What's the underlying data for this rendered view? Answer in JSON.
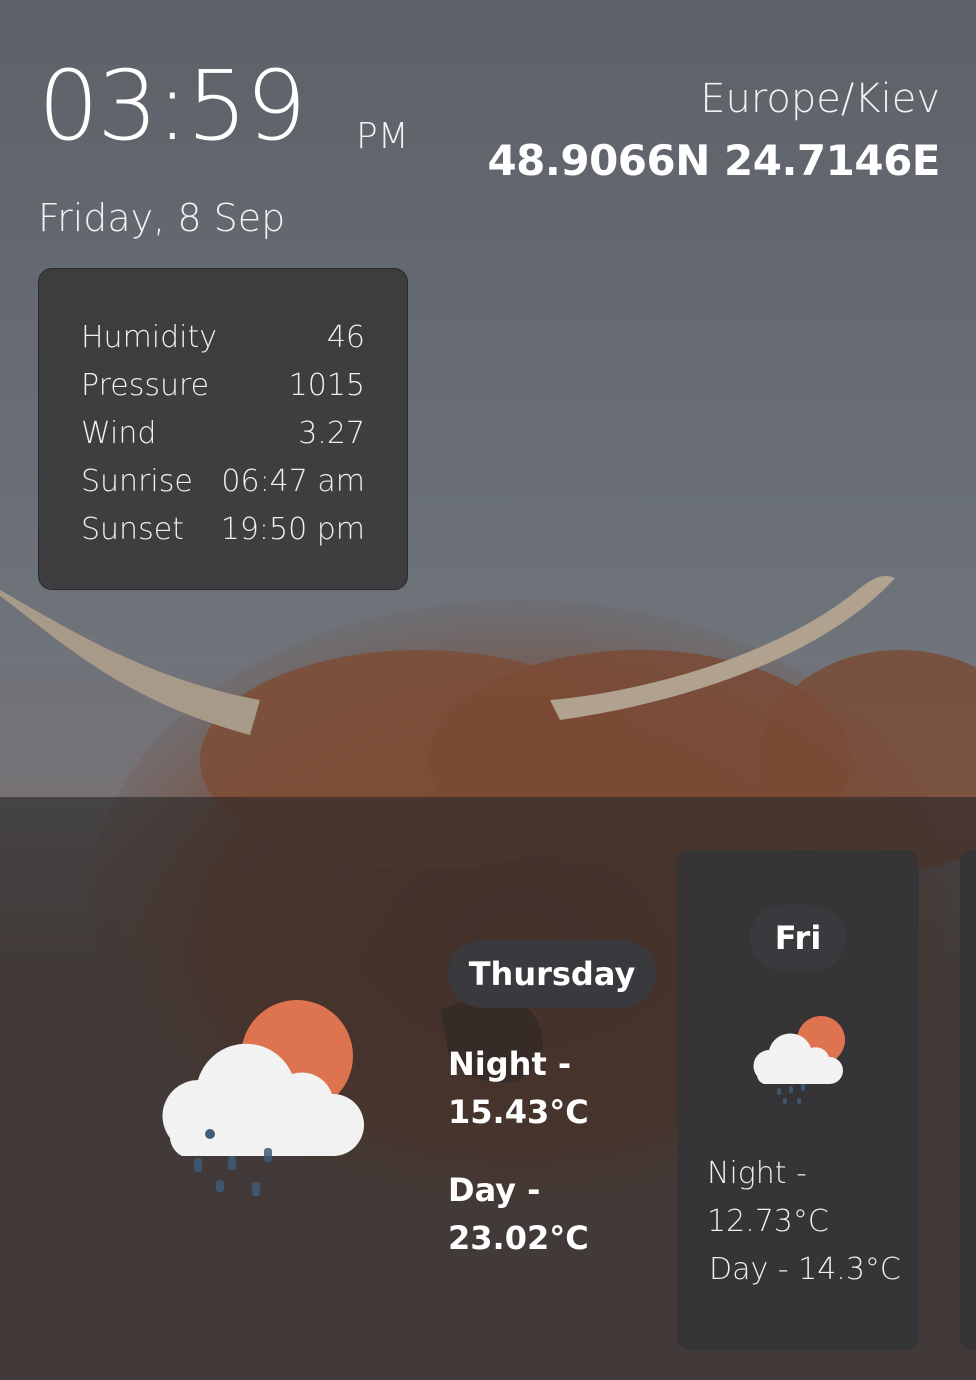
{
  "clock": {
    "time": "03:59",
    "ampm": "PM",
    "date": "Friday, 8 Sep"
  },
  "location": {
    "timezone": "Europe/Kiev",
    "coordinates": "48.9066N 24.7146E"
  },
  "details": [
    {
      "label": "Humidity",
      "value": "46"
    },
    {
      "label": "Pressure",
      "value": "1015"
    },
    {
      "label": "Wind",
      "value": "3.27"
    },
    {
      "label": "Sunrise",
      "value": "06:47 am"
    },
    {
      "label": "Sunset",
      "value": "19:50 pm"
    }
  ],
  "today": {
    "day": "Thursday",
    "icon": "cloud-sun-rain-icon",
    "night_label": "Night -",
    "night_temp": "15.43°C",
    "day_label": "Day -",
    "day_temp": "23.02°C"
  },
  "forecast": [
    {
      "day": "Fri",
      "icon": "cloud-sun-rain-icon",
      "night_label": "Night -",
      "night_temp": "12.73°C",
      "day_line": "Day - 14.3°C"
    }
  ],
  "colors": {
    "sun": "#de7350",
    "cloud": "#f2f2f2",
    "rain": "#3f5d78",
    "card": "#3a3a3c",
    "pill": "#3a3a3e"
  }
}
